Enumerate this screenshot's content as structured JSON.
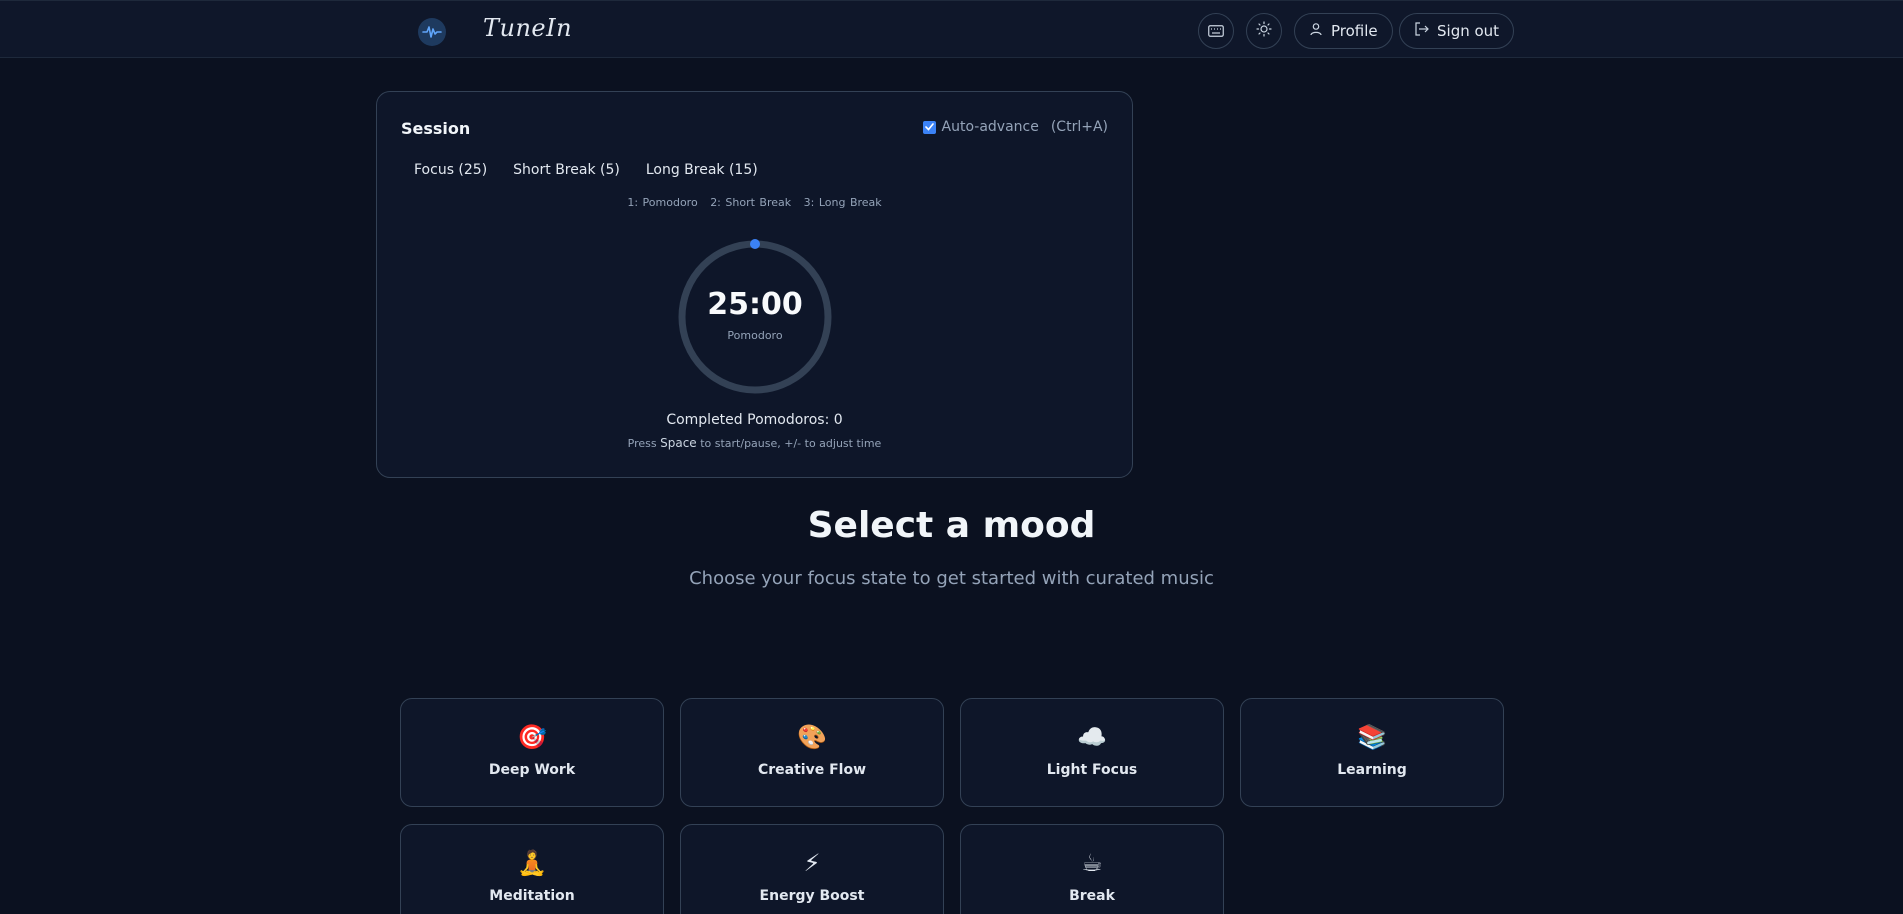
{
  "brand": {
    "name": "TuneIn"
  },
  "header": {
    "keyboard_icon": "keyboard-icon",
    "theme_icon": "sun-icon",
    "profile_label": "Profile",
    "signout_label": "Sign out"
  },
  "session": {
    "title": "Session",
    "auto_advance_label": "Auto-advance",
    "auto_advance_checked": true,
    "auto_advance_shortcut": "(Ctrl+A)",
    "tabs": [
      {
        "label": "Focus (25)"
      },
      {
        "label": "Short Break (5)"
      },
      {
        "label": "Long Break (15)"
      }
    ],
    "shortcuts": [
      "1: Pomodoro",
      "2: Short Break",
      "3: Long Break"
    ],
    "timer_value": "25:00",
    "timer_label": "Pomodoro",
    "progress_fraction": 0,
    "completed_text": "Completed Pomodoros: 0",
    "hint_prefix": "Press",
    "hint_key": "Space",
    "hint_suffix": "to start/pause, +/- to adjust time"
  },
  "mood": {
    "title": "Select a mood",
    "subtitle": "Choose your focus state to get started with curated music",
    "items": [
      {
        "emoji": "🎯",
        "label": "Deep Work"
      },
      {
        "emoji": "🎨",
        "label": "Creative Flow"
      },
      {
        "emoji": "☁️",
        "label": "Light Focus"
      },
      {
        "emoji": "📚",
        "label": "Learning"
      },
      {
        "emoji": "🧘",
        "label": "Meditation"
      },
      {
        "emoji": "⚡",
        "label": "Energy Boost"
      },
      {
        "emoji": "☕",
        "label": "Break"
      }
    ]
  },
  "colors": {
    "background": "#0b1120",
    "card": "#0e1629",
    "accent": "#3b82f6",
    "border": "#334155"
  }
}
